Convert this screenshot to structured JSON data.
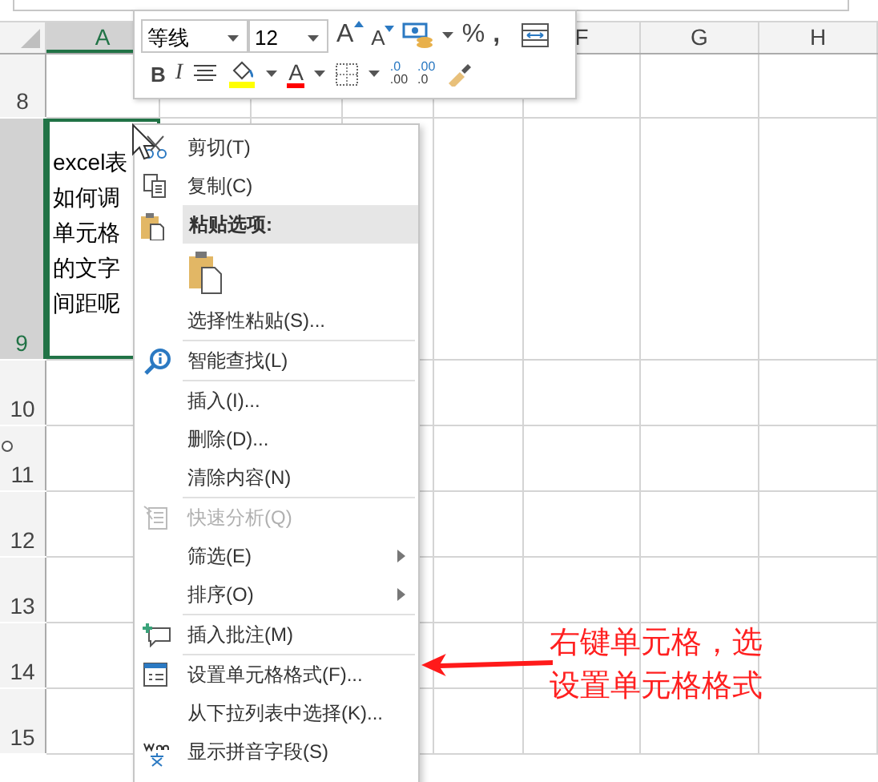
{
  "columns": [
    {
      "label": "A",
      "selected": true
    },
    {
      "label": "F",
      "selected": false
    },
    {
      "label": "G",
      "selected": false
    },
    {
      "label": "H",
      "selected": false
    }
  ],
  "rows": [
    {
      "label": "8",
      "selected": false
    },
    {
      "label": "9",
      "selected": true
    },
    {
      "label": "10",
      "selected": false
    },
    {
      "label": "11",
      "selected": false
    },
    {
      "label": "12",
      "selected": false
    },
    {
      "label": "13",
      "selected": false
    },
    {
      "label": "14",
      "selected": false
    },
    {
      "label": "15",
      "selected": false
    }
  ],
  "cell_lines": [
    "excel表",
    "如何调",
    "单元格",
    "的文字",
    "间距呢"
  ],
  "mini_toolbar": {
    "font": "等线",
    "size": "12",
    "grow_label": "A",
    "shrink_label": "A",
    "percent": "%",
    "comma": ",",
    "bold": "B",
    "italic": "I",
    "font_color_label": "A",
    "increase_decimal": [
      ".0",
      ".00"
    ],
    "decrease_decimal": [
      ".00",
      ".0"
    ]
  },
  "context_menu": [
    {
      "kind": "item",
      "label": "剪切(T)",
      "disabled": false,
      "submenu": false
    },
    {
      "kind": "item",
      "label": "复制(C)",
      "disabled": false,
      "submenu": false
    },
    {
      "kind": "header",
      "label": "粘贴选项:"
    },
    {
      "kind": "paste"
    },
    {
      "kind": "item",
      "label": "选择性粘贴(S)...",
      "disabled": false,
      "submenu": false
    },
    {
      "kind": "separator"
    },
    {
      "kind": "item",
      "label": "智能查找(L)",
      "disabled": false,
      "submenu": false
    },
    {
      "kind": "separator"
    },
    {
      "kind": "item",
      "label": "插入(I)...",
      "disabled": false,
      "submenu": false
    },
    {
      "kind": "item",
      "label": "删除(D)...",
      "disabled": false,
      "submenu": false
    },
    {
      "kind": "item",
      "label": "清除内容(N)",
      "disabled": false,
      "submenu": false
    },
    {
      "kind": "separator"
    },
    {
      "kind": "item",
      "label": "快速分析(Q)",
      "disabled": true,
      "submenu": false
    },
    {
      "kind": "item",
      "label": "筛选(E)",
      "disabled": false,
      "submenu": true
    },
    {
      "kind": "item",
      "label": "排序(O)",
      "disabled": false,
      "submenu": true
    },
    {
      "kind": "separator"
    },
    {
      "kind": "item",
      "label": "插入批注(M)",
      "disabled": false,
      "submenu": false
    },
    {
      "kind": "separator"
    },
    {
      "kind": "item",
      "label": "设置单元格格式(F)...",
      "disabled": false,
      "submenu": false
    },
    {
      "kind": "item",
      "label": "从下拉列表中选择(K)...",
      "disabled": false,
      "submenu": false
    },
    {
      "kind": "item",
      "label": "显示拼音字段(S)",
      "disabled": false,
      "submenu": false
    }
  ],
  "annotation": [
    "右键单元格，选",
    "设置单元格格式"
  ]
}
